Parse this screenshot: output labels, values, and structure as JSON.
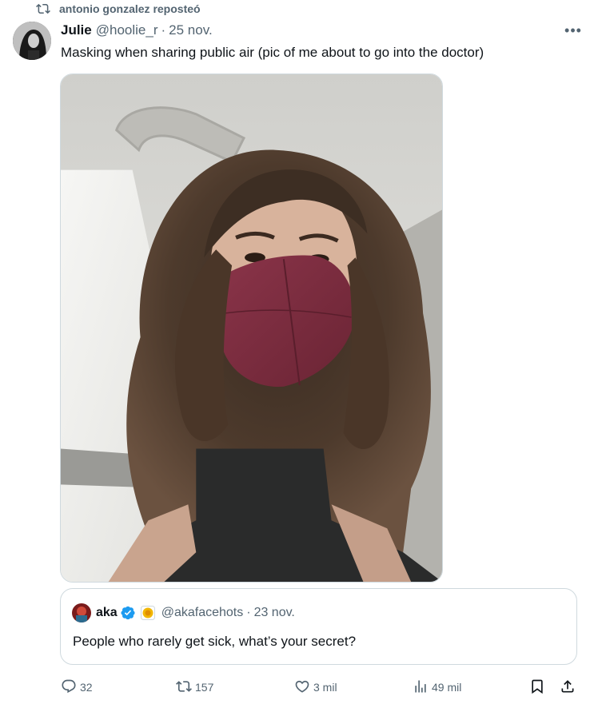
{
  "repost": {
    "label": "antonio gonzalez reposteó"
  },
  "tweet": {
    "name": "Julie",
    "handle": "@hoolie_r",
    "separator": "·",
    "date": "25 nov.",
    "more": "•••",
    "text": "Masking when sharing public air (pic of me about to go into the doctor)"
  },
  "quote": {
    "name": "aka",
    "handle": "@akafacehots",
    "separator": "·",
    "date": "23 nov.",
    "text": "People who rarely get sick, what’s your secret?"
  },
  "actions": {
    "replies": "32",
    "reposts": "157",
    "likes": "3 mil",
    "views": "49 mil"
  },
  "icons": [
    "repost-icon",
    "more-icon",
    "verified-badge-icon",
    "affiliate-badge-icon",
    "reply-icon",
    "like-icon",
    "views-icon",
    "bookmark-icon",
    "share-icon"
  ],
  "colors": {
    "text": "#0f1419",
    "secondary": "#536471",
    "border": "#cfd9de",
    "verified": "#1d9bf0",
    "mask": "#7a2a3e"
  }
}
